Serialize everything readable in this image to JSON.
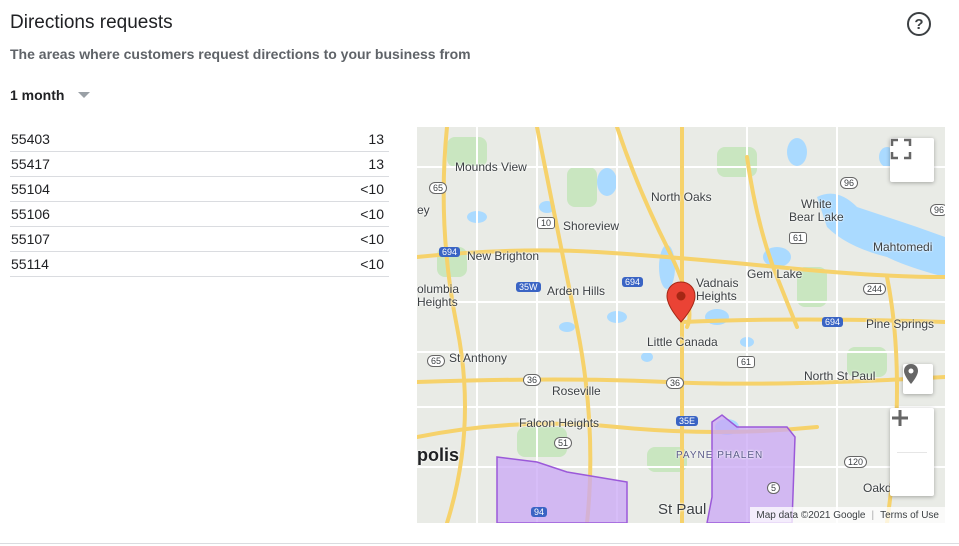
{
  "header": {
    "title": "Directions requests",
    "subtitle": "The areas where customers request directions to your business from",
    "help_icon": "?"
  },
  "period": {
    "selected": "1 month"
  },
  "table": {
    "rows": [
      {
        "zip": "55403",
        "count": "13"
      },
      {
        "zip": "55417",
        "count": "13"
      },
      {
        "zip": "55104",
        "count": "<10"
      },
      {
        "zip": "55106",
        "count": "<10"
      },
      {
        "zip": "55107",
        "count": "<10"
      },
      {
        "zip": "55114",
        "count": "<10"
      }
    ]
  },
  "map": {
    "labels": {
      "mounds_view": "Mounds View",
      "north_oaks": "North Oaks",
      "white_bear_lake": "White\nBear Lake",
      "shoreview": "Shoreview",
      "new_brighton": "New Brighton",
      "mahtomedi": "Mahtomedi",
      "gem_lake": "Gem Lake",
      "vadnais_heights": "Vadnais\nHeights",
      "columbia_heights": "olumbia\nHeights",
      "arden_hills": "Arden Hills",
      "pine_springs": "Pine Springs",
      "little_canada": "Little Canada",
      "st_anthony": "St Anthony",
      "north_st_paul": "North St Paul",
      "roseville": "Roseville",
      "falcon_heights": "Falcon Heights",
      "payne_phalen": "PAYNE  PHALEN",
      "minneapolis": "polis",
      "oakdale": "Oakd",
      "st_paul": "St Paul",
      "ey": "ey"
    },
    "shields": {
      "i694_a": "694",
      "i694_b": "694",
      "i694_c": "694",
      "i35w": "35W",
      "i35e": "35E",
      "i94": "94",
      "s65a": "65",
      "s65b": "65",
      "s10": "10",
      "s96": "96",
      "s96b": "96",
      "s61a": "61",
      "s61b": "61",
      "s36a": "36",
      "s36b": "36",
      "s244": "244",
      "s51": "51",
      "s120": "120",
      "s5": "5"
    },
    "attribution": {
      "map_data": "Map data ©2021 Google",
      "terms": "Terms of Use"
    },
    "colors": {
      "road": "#f6d26b",
      "water": "#aadaff",
      "park": "#c9e6c0",
      "region": "#c9a7f5",
      "pin": "#ea4335"
    }
  }
}
